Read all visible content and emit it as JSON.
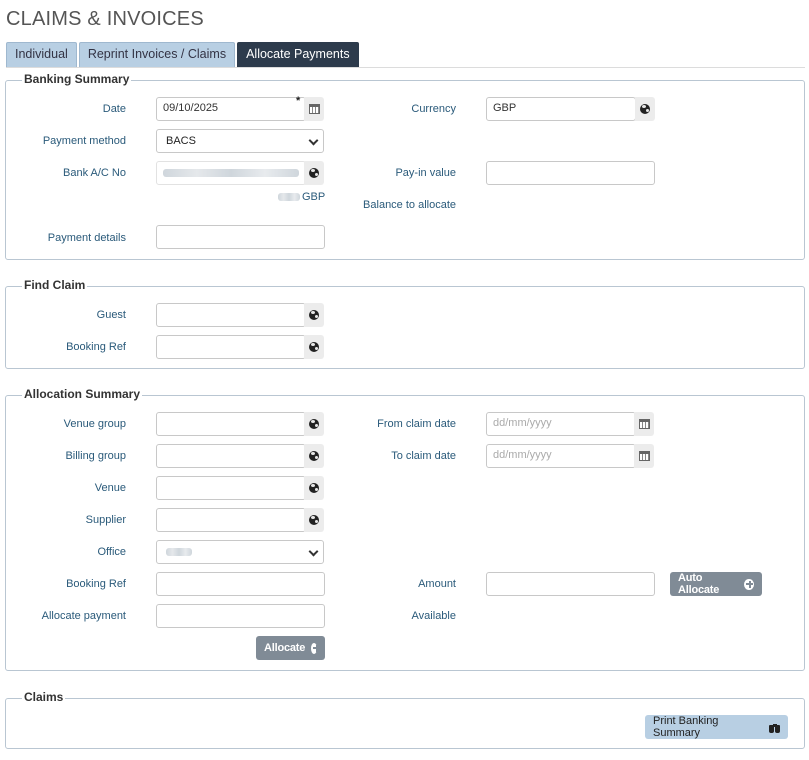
{
  "page_title": "CLAIMS & INVOICES",
  "tabs": [
    {
      "label": "Individual",
      "active": false
    },
    {
      "label": "Reprint Invoices / Claims",
      "active": false
    },
    {
      "label": "Allocate Payments",
      "active": true
    }
  ],
  "banking_summary": {
    "legend": "Banking Summary",
    "date_label": "Date",
    "date_value": "09/10/2025",
    "required_mark": "*",
    "currency_label": "Currency",
    "currency_value": "GBP",
    "payment_method_label": "Payment method",
    "payment_method_value": "BACS",
    "bank_ac_label": "Bank A/C No",
    "pay_in_label": "Pay-in value",
    "pay_in_value": "",
    "balance_label": "Balance to allocate",
    "balance_currency": "GBP",
    "payment_details_label": "Payment details",
    "payment_details_value": ""
  },
  "find_claim": {
    "legend": "Find Claim",
    "guest_label": "Guest",
    "guest_value": "",
    "booking_ref_label": "Booking Ref",
    "booking_ref_value": ""
  },
  "allocation_summary": {
    "legend": "Allocation Summary",
    "venue_group_label": "Venue group",
    "billing_group_label": "Billing group",
    "venue_label": "Venue",
    "supplier_label": "Supplier",
    "office_label": "Office",
    "booking_ref_label": "Booking Ref",
    "allocate_payment_label": "Allocate payment",
    "from_claim_date_label": "From claim date",
    "from_claim_date_placeholder": "dd/mm/yyyy",
    "to_claim_date_label": "To claim date",
    "to_claim_date_placeholder": "dd/mm/yyyy",
    "amount_label": "Amount",
    "available_label": "Available",
    "auto_allocate_button": "Auto Allocate",
    "allocate_button": "Allocate"
  },
  "claims": {
    "legend": "Claims",
    "print_button": "Print Banking Summary"
  },
  "colors": {
    "tab_active": "#2d3b4c",
    "tab_inactive": "#b8cfe3",
    "label_text": "#2a5a7a",
    "button_dark": "#808b96",
    "button_light": "#b8cfe3"
  }
}
